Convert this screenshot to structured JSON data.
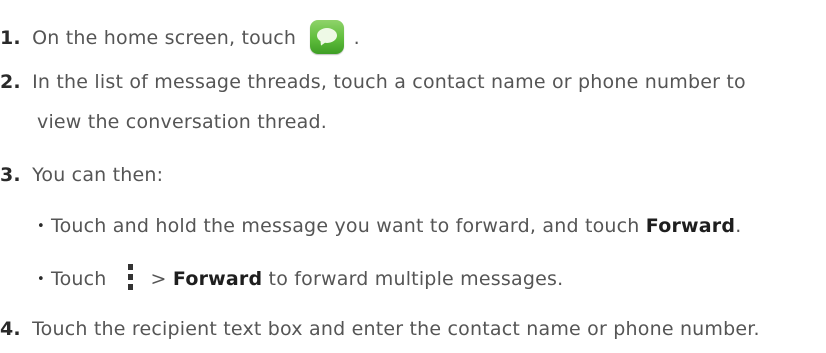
{
  "steps": [
    {
      "number": "1.",
      "text_before_icon": "On the home screen, touch",
      "icon": "messaging-app-icon",
      "text_after_icon": "."
    },
    {
      "number": "2.",
      "line1": "In the list of message threads, touch a contact name or phone number to",
      "line2": "view the conversation thread."
    },
    {
      "number": "3.",
      "text": "You can then:",
      "bullets": [
        {
          "bullet": "•",
          "text": "Touch and hold the message you want to forward, and touch",
          "bold": "Forward",
          "after": "."
        },
        {
          "bullet": "•",
          "before_icon": "Touch",
          "icon": "menu-icon",
          "arrow": ">",
          "bold": "Forward",
          "after": " to forward multiple messages."
        }
      ]
    },
    {
      "number": "4.",
      "text": "Touch the recipient text box and enter the contact name or phone number."
    }
  ]
}
